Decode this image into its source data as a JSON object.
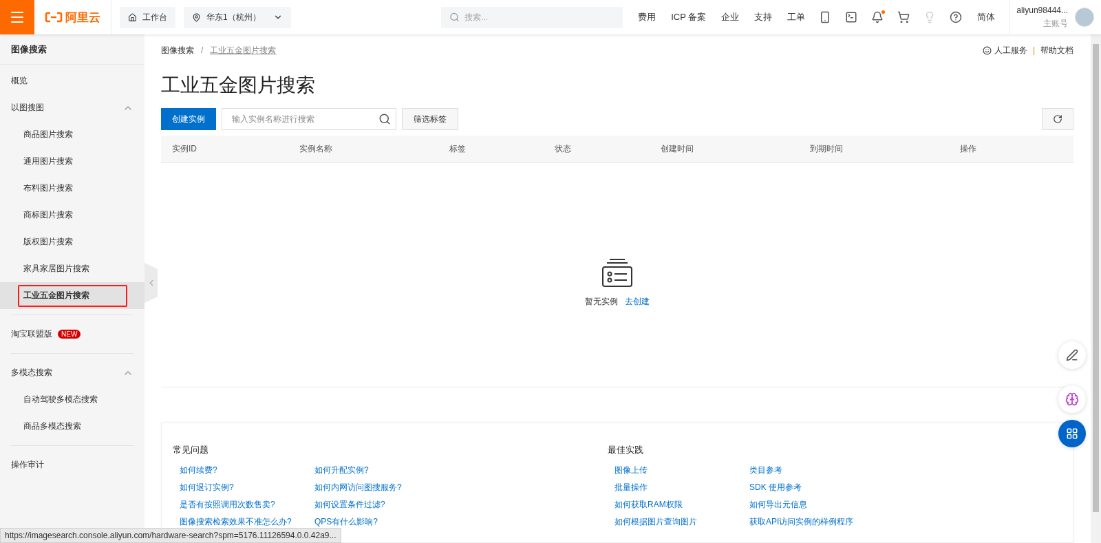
{
  "header": {
    "logo": "阿里云",
    "workbench": "工作台",
    "region": "华东1（杭州）",
    "search": {
      "placeholder": "搜索..."
    },
    "nav": [
      "费用",
      "ICP 备案",
      "企业",
      "支持",
      "工单"
    ],
    "notifications": {
      "unread": true
    },
    "language": "简体",
    "user": {
      "name": "aliyun98444...",
      "role": "主账号"
    }
  },
  "sidebar": {
    "title": "图像搜索",
    "sections": [
      [
        {
          "kind": "item",
          "label": "概览",
          "selected": false
        },
        {
          "kind": "group",
          "label": "以图搜图",
          "expanded": true,
          "children": [
            {
              "label": "商品图片搜索",
              "selected": false,
              "marked": false
            },
            {
              "label": "通用图片搜索",
              "selected": false,
              "marked": false
            },
            {
              "label": "布料图片搜索",
              "selected": false,
              "marked": false
            },
            {
              "label": "商标图片搜索",
              "selected": false,
              "marked": false
            },
            {
              "label": "版权图片搜索",
              "selected": false,
              "marked": false
            },
            {
              "label": "家具家居图片搜索",
              "selected": false,
              "marked": false
            },
            {
              "label": "工业五金图片搜索",
              "selected": true,
              "marked": true
            }
          ]
        }
      ],
      [
        {
          "kind": "item",
          "label": "淘宝联盟版",
          "selected": false,
          "badge": "NEW"
        }
      ],
      [
        {
          "kind": "group",
          "label": "多模态搜索",
          "expanded": true,
          "children": [
            {
              "label": "自动驾驶多模态搜索",
              "selected": false,
              "marked": false
            },
            {
              "label": "商品多模态搜索",
              "selected": false,
              "marked": false
            }
          ]
        }
      ],
      [
        {
          "kind": "item",
          "label": "操作审计",
          "selected": false
        }
      ]
    ]
  },
  "main": {
    "breadcrumb": [
      "图像搜索",
      "工业五金图片搜索"
    ],
    "breadcrumb_separator": "/",
    "help_links": [
      "人工服务",
      "帮助文档"
    ],
    "help_separator": "|",
    "title": "工业五金图片搜索",
    "create_button": "创建实例",
    "search": {
      "placeholder": "输入实例名称进行搜索"
    },
    "filter_button": "筛选标签",
    "table": {
      "columns": [
        "实例ID",
        "实例名称",
        "标签",
        "状态",
        "创建时间",
        "到期时间",
        "操作"
      ]
    },
    "empty": {
      "text": "暂无实例",
      "link": "去创建"
    },
    "faq": [
      {
        "title": "常见问题",
        "columns": [
          [
            "如何续费?",
            "如何退订实例?",
            "是否有按照调用次数售卖?",
            "图像搜索检索效果不准怎么办?"
          ],
          [
            "如何升配实例?",
            "如何内网访问图搜服务?",
            "如何设置条件过滤?",
            "QPS有什么影响?"
          ]
        ]
      },
      {
        "title": "最佳实践",
        "columns": [
          [
            "图像上传",
            "批量操作",
            "如何获取RAM权限",
            "如何根据图片查询图片"
          ],
          [
            "类目参考",
            "SDK 使用参考",
            "如何导出元信息",
            "获取API访问实例的样例程序"
          ]
        ]
      }
    ]
  },
  "status_bar": {
    "url": "https://imagesearch.console.aliyun.com/hardware-search?spm=5176.11126594.0.0.42a9..."
  }
}
